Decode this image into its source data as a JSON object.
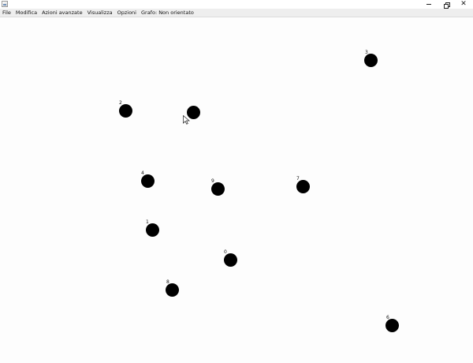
{
  "window": {
    "icon": "java-app-icon",
    "controls": [
      "minimize-icon",
      "restore-icon",
      "close-icon"
    ]
  },
  "menubar": {
    "items": [
      "File",
      "Modifica",
      "Azioni avanzate",
      "Visualizza",
      "Opzioni",
      "Grafo: Non orientato"
    ]
  },
  "graph": {
    "nodes": [
      {
        "label": "0"
      },
      {
        "label": "1"
      },
      {
        "label": "2"
      },
      {
        "label": "3"
      },
      {
        "label": "4"
      },
      {
        "label": "6"
      },
      {
        "label": "7"
      },
      {
        "label": "8"
      },
      {
        "label": "9"
      },
      {
        "label": ""
      }
    ],
    "node_color": "#000000"
  }
}
